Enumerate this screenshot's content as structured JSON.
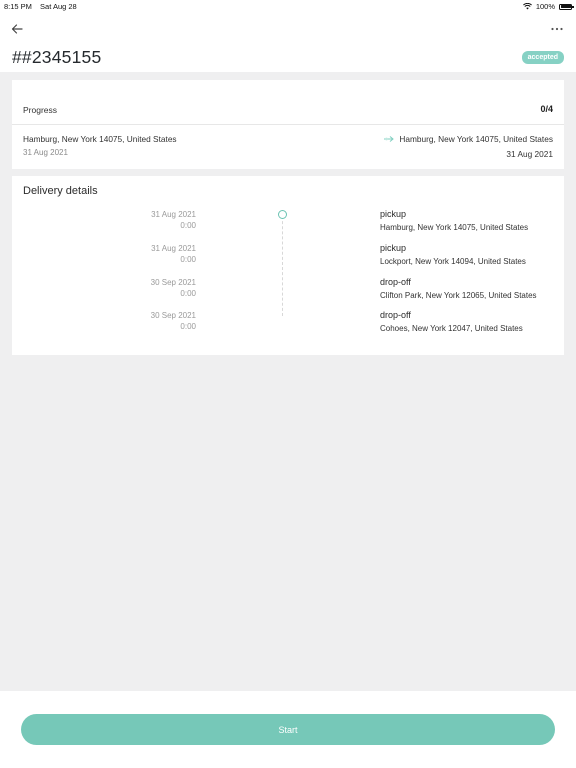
{
  "status_bar": {
    "time": "8:15 PM",
    "date": "Sat Aug 28",
    "battery": "100%"
  },
  "header": {
    "order_id": "##2345155",
    "status_badge": "accepted"
  },
  "progress": {
    "label": "Progress",
    "value": "0/4",
    "from_address": "Hamburg, New York 14075, United States",
    "from_date": "31 Aug 2021",
    "to_address": "Hamburg, New York 14075, United States",
    "to_date": "31 Aug 2021"
  },
  "delivery": {
    "title": "Delivery details",
    "stops": [
      {
        "date": "31 Aug 2021",
        "time": "0:00",
        "type": "pickup",
        "address": "Hamburg, New York 14075, United States"
      },
      {
        "date": "31 Aug 2021",
        "time": "0:00",
        "type": "pickup",
        "address": "Lockport, New York 14094, United States"
      },
      {
        "date": "30 Sep 2021",
        "time": "0:00",
        "type": "drop-off",
        "address": "Clifton Park, New York 12065, United States"
      },
      {
        "date": "30 Sep 2021",
        "time": "0:00",
        "type": "drop-off",
        "address": "Cohoes, New York 12047, United States"
      }
    ]
  },
  "actions": {
    "start_label": "Start"
  },
  "colors": {
    "accent": "#76c8b8",
    "badge": "#86d1c4",
    "background": "#efeff0"
  },
  "icons": {
    "back": "arrow-left-icon",
    "more": "more-horizontal-icon",
    "wifi": "wifi-icon",
    "battery": "battery-icon",
    "route": "route-arrow-icon"
  }
}
